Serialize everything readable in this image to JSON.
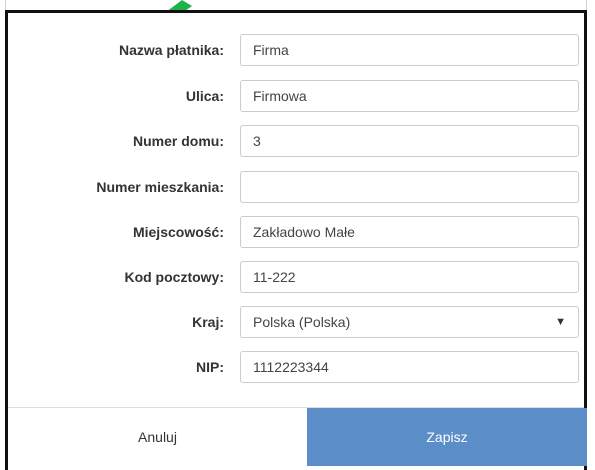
{
  "form": {
    "fields": [
      {
        "label": "Nazwa płatnika:",
        "value": "Firma"
      },
      {
        "label": "Ulica:",
        "value": "Firmowa"
      },
      {
        "label": "Numer domu:",
        "value": "3"
      },
      {
        "label": "Numer mieszkania:",
        "value": ""
      },
      {
        "label": "Miejscowość:",
        "value": "Zakładowo Małe"
      },
      {
        "label": "Kod pocztowy:",
        "value": "11-222"
      },
      {
        "label": "Kraj:",
        "value": "Polska (Polska)"
      },
      {
        "label": "NIP:",
        "value": "1112223344"
      }
    ],
    "select_arrow": "▼"
  },
  "footer": {
    "cancel_label": "Anuluj",
    "save_label": "Zapisz"
  },
  "colors": {
    "save_button": "#5b8dc9",
    "annotation_arrow": "#1db24a"
  },
  "icons": {
    "annotation": "green-arrow-icon",
    "dropdown": "chevron-down-icon"
  }
}
